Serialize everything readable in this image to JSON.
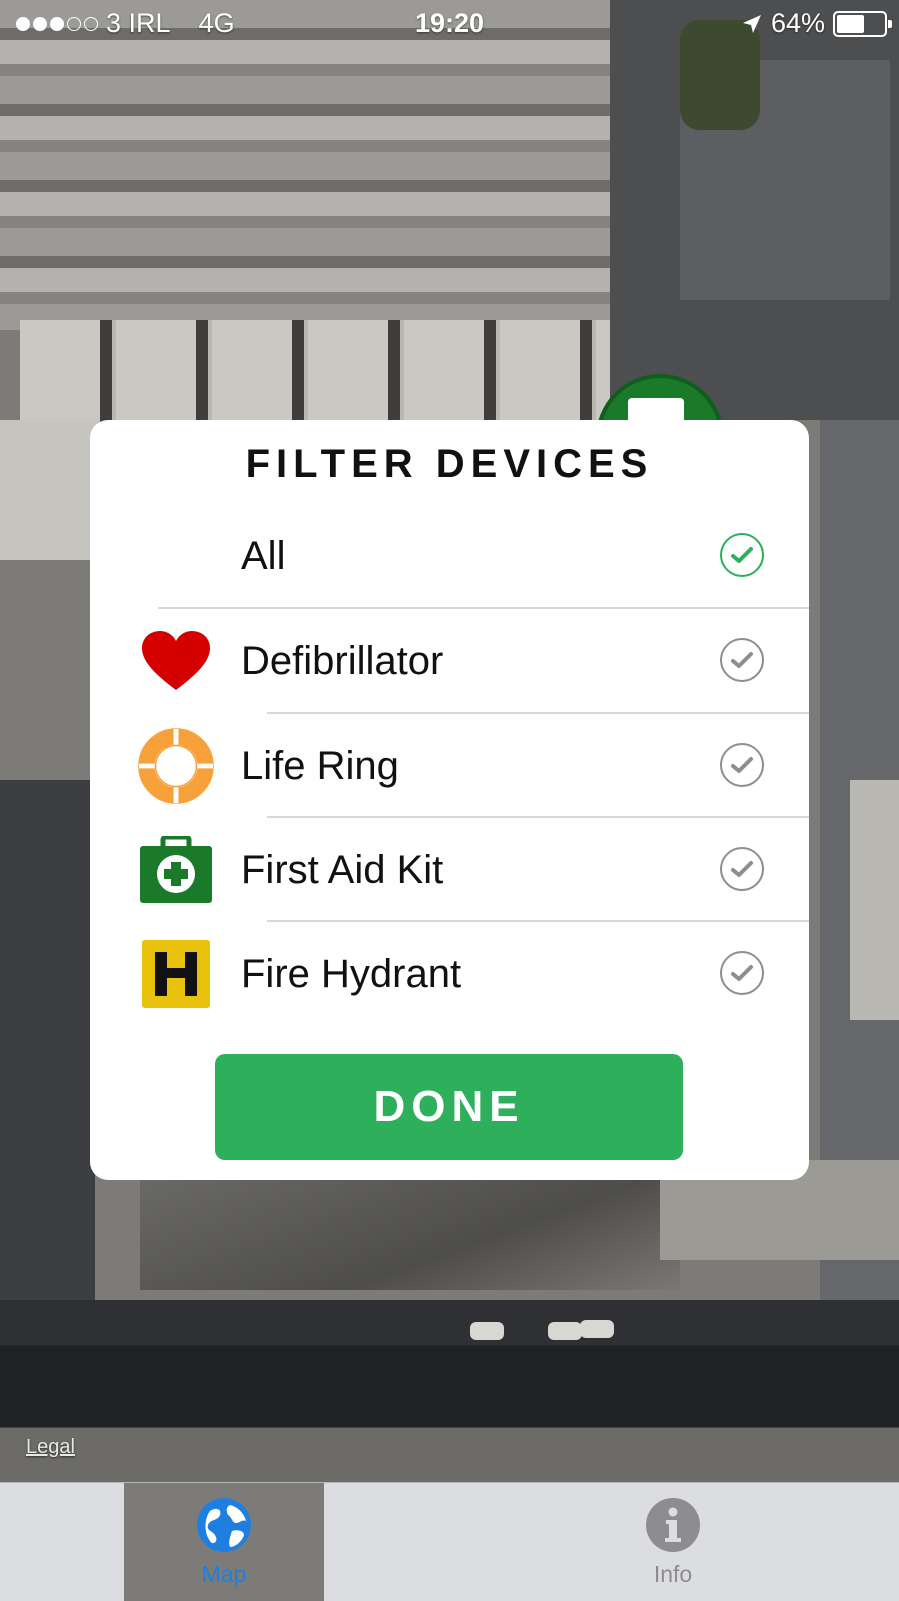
{
  "status_bar": {
    "carrier": "3 IRL",
    "network": "4G",
    "time": "19:20",
    "battery": "64%",
    "battery_level": 0.64,
    "signal_bars": 3,
    "signal_total": 5
  },
  "map": {
    "legal": "Legal"
  },
  "modal": {
    "title": "FILTER DEVICES",
    "options": [
      {
        "label": "All",
        "icon": "none",
        "checked": true
      },
      {
        "label": "Defibrillator",
        "icon": "heart-icon",
        "checked": false
      },
      {
        "label": "Life Ring",
        "icon": "life-ring-icon",
        "checked": false
      },
      {
        "label": "First Aid Kit",
        "icon": "first-aid-kit-icon",
        "checked": false
      },
      {
        "label": "Fire Hydrant",
        "icon": "fire-hydrant-icon",
        "checked": false
      }
    ],
    "done_label": "DONE"
  },
  "tabbar": {
    "tabs": [
      {
        "label": "Map",
        "icon": "globe-icon",
        "active": true
      },
      {
        "label": "Info",
        "icon": "info-icon",
        "active": false
      }
    ]
  },
  "colors": {
    "accent_green": "#2eaf5c",
    "tab_active_blue": "#1f7fe0",
    "heart_red": "#d40000",
    "life_ring_orange": "#f7a13a",
    "first_aid_green": "#1a7a2a",
    "hydrant_yellow": "#e8c20c"
  }
}
